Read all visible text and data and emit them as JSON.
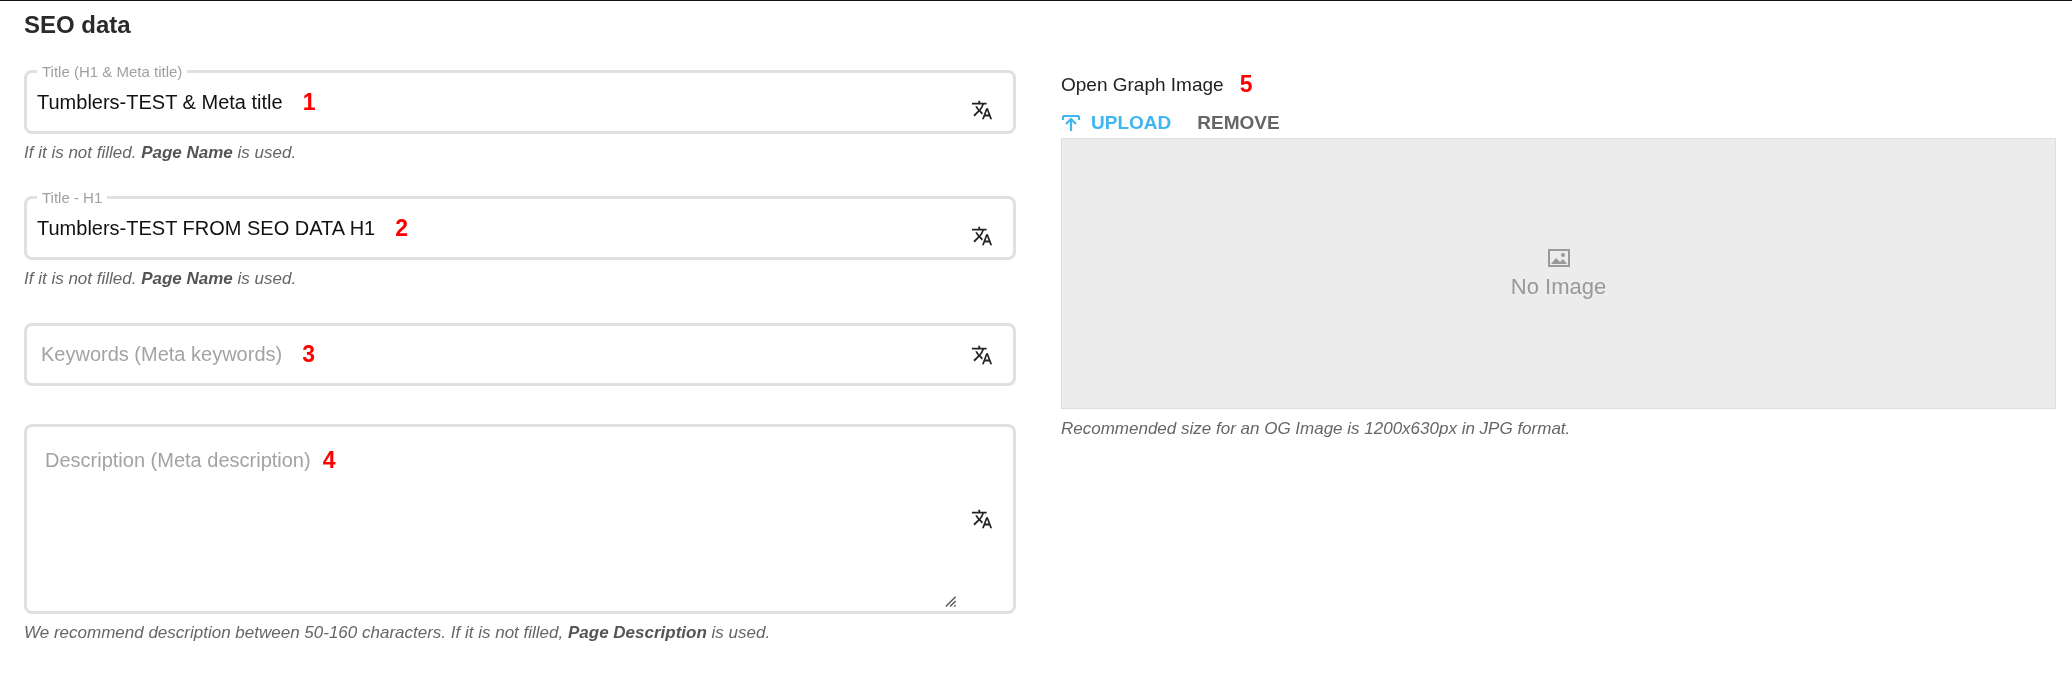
{
  "section": {
    "title": "SEO data"
  },
  "fields": [
    {
      "kind": "input",
      "label": "Title (H1 & Meta title)",
      "value": "Tumblers-TEST & Meta title",
      "marker": "1",
      "hint": "If it is not filled. **Page Name** is used."
    },
    {
      "kind": "input",
      "label": "Title - H1",
      "value": "Tumblers-TEST FROM SEO DATA H1",
      "marker": "2",
      "hint": "If it is not filled. **Page Name** is used."
    },
    {
      "kind": "input",
      "placeholder": "Keywords (Meta keywords)",
      "marker": "3"
    },
    {
      "kind": "textarea",
      "placeholder": "Description (Meta description)",
      "marker": "4",
      "hint": "We recommend description between 50-160 characters. If it is not filled, **Page Description** is used."
    }
  ],
  "og_image": {
    "label": "Open Graph Image",
    "marker": "5",
    "upload": "UPLOAD",
    "remove": "REMOVE",
    "empty_text": "No Image",
    "hint": "Recommended size for an OG Image is 1200x630px in JPG format."
  }
}
